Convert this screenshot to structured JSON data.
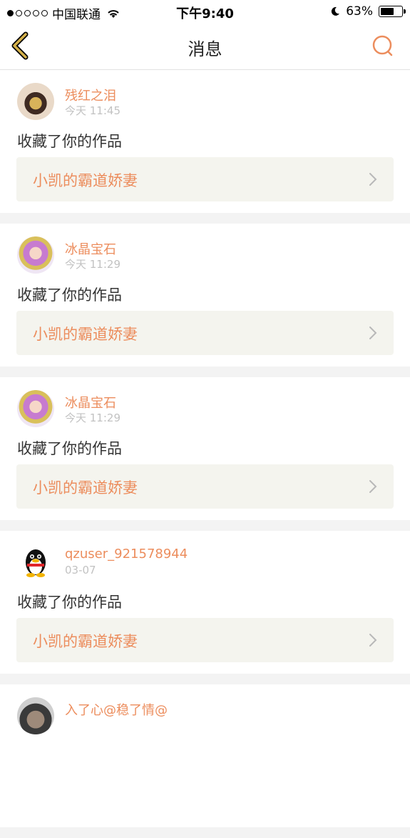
{
  "status_bar": {
    "signal_dots": 5,
    "signal_filled": 1,
    "carrier": "中国联通",
    "time": "下午9:40",
    "battery_percent": "63%",
    "battery_level": 0.63
  },
  "nav": {
    "title": "消息",
    "back_icon": "chevron-left-icon",
    "search_icon": "search-icon",
    "accent_color": "#ec8d5d",
    "back_color": "#d5b14a"
  },
  "messages": [
    {
      "user": "残红之泪",
      "time": "今天 11:45",
      "action": "收藏了你的作品",
      "work_title": "小凯的霸道娇妻",
      "avatar": "flower"
    },
    {
      "user": "冰晶宝石",
      "time": "今天 11:29",
      "action": "收藏了你的作品",
      "work_title": "小凯的霸道娇妻",
      "avatar": "girl"
    },
    {
      "user": "冰晶宝石",
      "time": "今天 11:29",
      "action": "收藏了你的作品",
      "work_title": "小凯的霸道娇妻",
      "avatar": "girl"
    },
    {
      "user": "qzuser_921578944",
      "time": "03-07",
      "action": "收藏了你的作品",
      "work_title": "小凯的霸道娇妻",
      "avatar": "penguin"
    },
    {
      "user": "入了心@稳了情@",
      "time": "",
      "action": "",
      "work_title": "",
      "avatar": "boy"
    }
  ]
}
